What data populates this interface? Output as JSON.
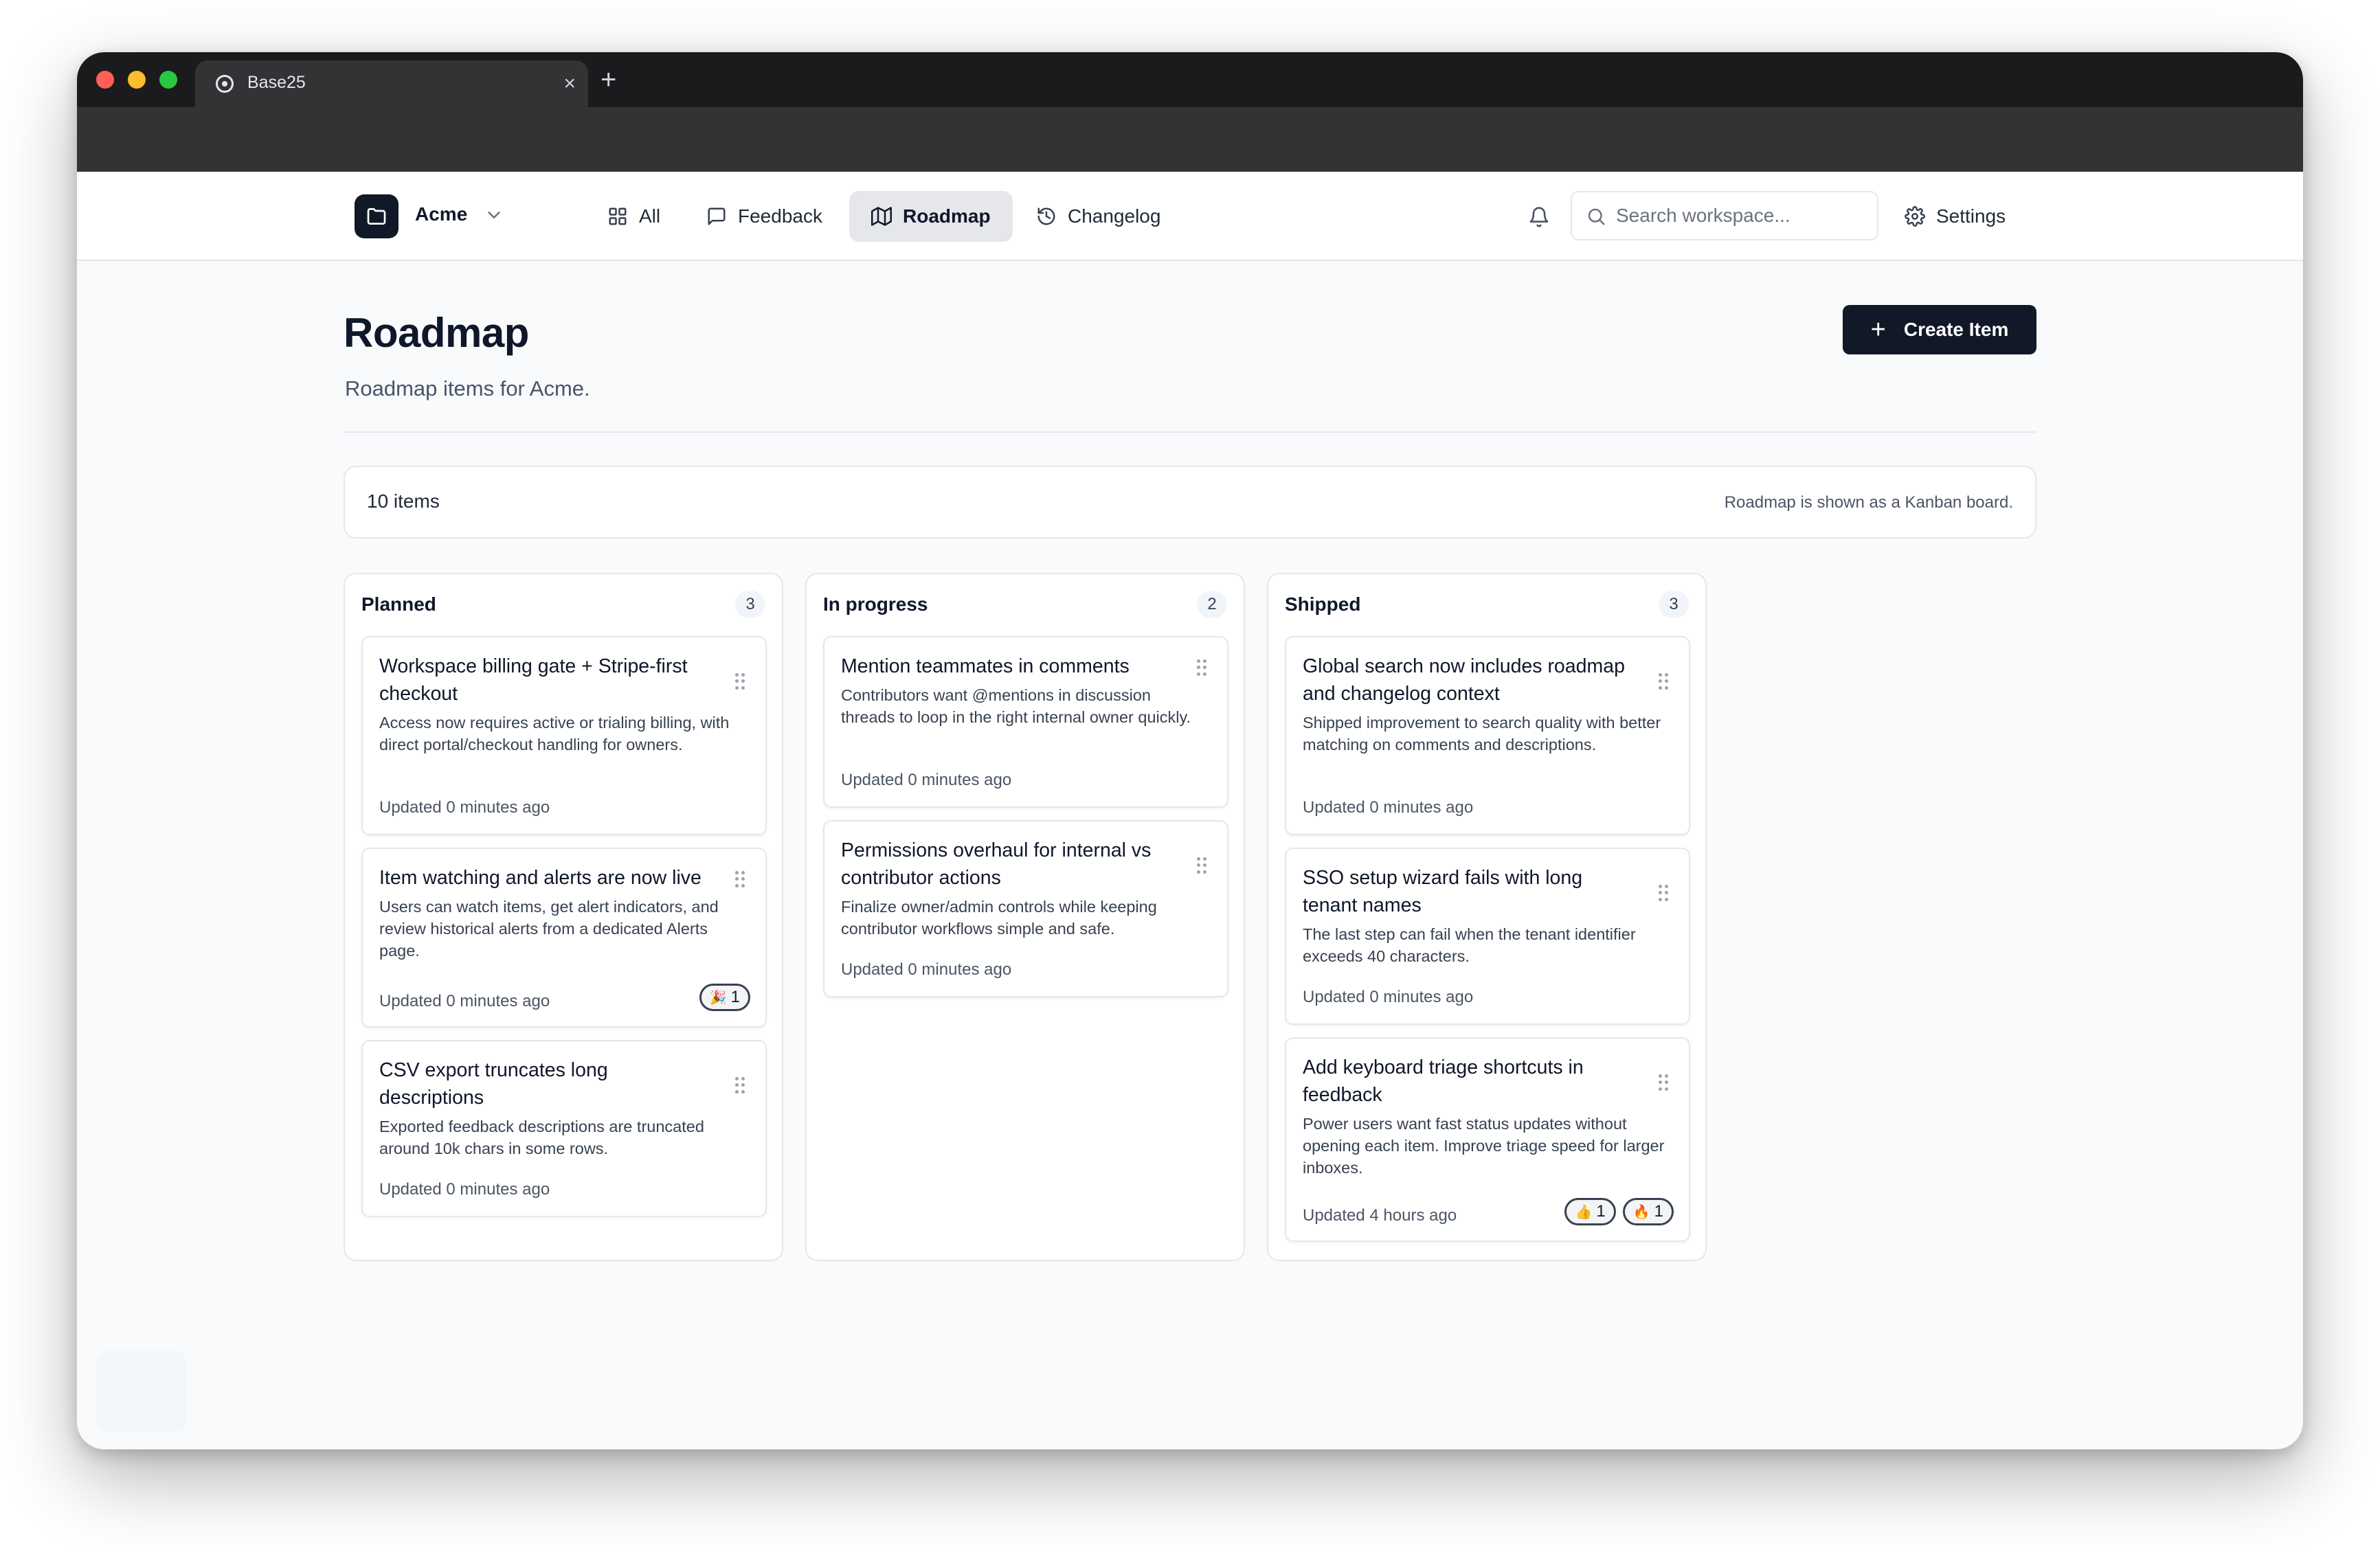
{
  "browser": {
    "tab_title": "Base25",
    "tab_close": "×",
    "new_tab": "+"
  },
  "header": {
    "workspace_name": "Acme",
    "nav": [
      {
        "label": "All",
        "icon": "grid-icon"
      },
      {
        "label": "Feedback",
        "icon": "message-square-icon"
      },
      {
        "label": "Roadmap",
        "icon": "map-icon"
      },
      {
        "label": "Changelog",
        "icon": "history-icon"
      }
    ],
    "active_nav": "Roadmap",
    "search_placeholder": "Search workspace...",
    "settings_label": "Settings"
  },
  "page": {
    "title": "Roadmap",
    "subtitle": "Roadmap items for Acme.",
    "create_label": "Create Item",
    "item_count": "10 items",
    "view_note": "Roadmap is shown as a Kanban board."
  },
  "columns": [
    {
      "title": "Planned",
      "count": "3",
      "cards": [
        {
          "title": "Workspace billing gate + Stripe-first checkout",
          "description": "Access now requires active or trialing billing, with direct portal/checkout handling for owners.",
          "updated": "Updated 0 minutes ago",
          "reactions": []
        },
        {
          "title": "Item watching and alerts are now live",
          "description": "Users can watch items, get alert indicators, and review historical alerts from a dedicated Alerts page.",
          "updated": "Updated 0 minutes ago",
          "reactions": [
            {
              "emoji": "🎉",
              "count": "1"
            }
          ]
        },
        {
          "title": "CSV export truncates long descriptions",
          "description": "Exported feedback descriptions are truncated around 10k chars in some rows.",
          "updated": "Updated 0 minutes ago",
          "reactions": []
        }
      ]
    },
    {
      "title": "In progress",
      "count": "2",
      "cards": [
        {
          "title": "Mention teammates in comments",
          "description": "Contributors want @mentions in discussion threads to loop in the right internal owner quickly.",
          "updated": "Updated 0 minutes ago",
          "reactions": []
        },
        {
          "title": "Permissions overhaul for internal vs contributor actions",
          "description": "Finalize owner/admin controls while keeping contributor workflows simple and safe.",
          "updated": "Updated 0 minutes ago",
          "reactions": []
        }
      ]
    },
    {
      "title": "Shipped",
      "count": "3",
      "cards": [
        {
          "title": "Global search now includes roadmap and changelog context",
          "description": "Shipped improvement to search quality with better matching on comments and descriptions.",
          "updated": "Updated 0 minutes ago",
          "reactions": []
        },
        {
          "title": "SSO setup wizard fails with long tenant names",
          "description": "The last step can fail when the tenant identifier exceeds 40 characters.",
          "updated": "Updated 0 minutes ago",
          "reactions": []
        },
        {
          "title": "Add keyboard triage shortcuts in feedback",
          "description": "Power users want fast status updates without opening each item. Improve triage speed for larger inboxes.",
          "updated": "Updated 4 hours ago",
          "reactions": [
            {
              "emoji": "👍",
              "count": "1"
            },
            {
              "emoji": "🔥",
              "count": "1"
            }
          ]
        }
      ]
    }
  ]
}
